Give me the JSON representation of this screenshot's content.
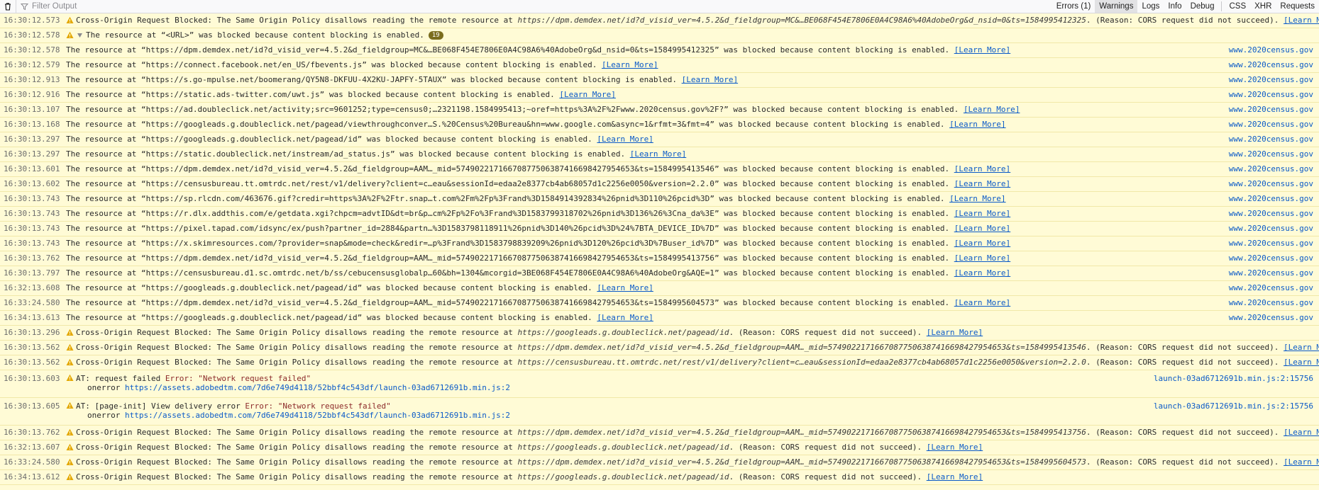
{
  "toolbar": {
    "filter_placeholder": "Filter Output",
    "buttons": [
      "Errors (1)",
      "Warnings",
      "Logs",
      "Info",
      "Debug"
    ],
    "buttons2": [
      "CSS",
      "XHR",
      "Requests"
    ]
  },
  "learn_more": "[Learn More]",
  "rows": [
    {
      "t": "16:30:12.573",
      "pre": "Cross-Origin Request Blocked: The Same Origin Policy disallows reading the remote resource at ",
      "url": "https://dpm.demdex.net/id?d_visid_ver=4.5.2&d_fieldgroup=MC&…BE068F454E7806E0A4C98A6%40AdobeOrg&d_nsid=0&ts=1584995412325",
      "post": ". (Reason: CORS request did not succeed). "
    },
    {
      "t": "16:30:12.578",
      "group": "The resource at “<URL>” was blocked because content blocking is enabled.",
      "count": "19"
    },
    {
      "t": "16:30:12.578",
      "child": true,
      "url": "https://dpm.demdex.net/id?d_visid_ver=4.5.2&d_fieldgroup=MC&…BE068F454E7806E0A4C98A6%40AdobeOrg&d_nsid=0&ts=1584995412325",
      "src": "www.2020census.gov"
    },
    {
      "t": "16:30:12.579",
      "child": true,
      "url": "https://connect.facebook.net/en_US/fbevents.js",
      "src": "www.2020census.gov"
    },
    {
      "t": "16:30:12.913",
      "child": true,
      "url": "https://s.go-mpulse.net/boomerang/QY5N8-DKFUU-4X2KU-JAPFY-5TAUX",
      "src": "www.2020census.gov"
    },
    {
      "t": "16:30:12.916",
      "child": true,
      "url": "https://static.ads-twitter.com/uwt.js",
      "src": "www.2020census.gov"
    },
    {
      "t": "16:30:13.107",
      "child": true,
      "url": "https://ad.doubleclick.net/activity;src=9601252;type=census0;…2321198.1584995413;~oref=https%3A%2F%2Fwww.2020census.gov%2F?",
      "src": "www.2020census.gov"
    },
    {
      "t": "16:30:13.168",
      "child": true,
      "url": "https://googleads.g.doubleclick.net/pagead/viewthroughconver…S.%20Census%20Bureau&hn=www.google.com&async=1&rfmt=3&fmt=4",
      "src": "www.2020census.gov"
    },
    {
      "t": "16:30:13.297",
      "child": true,
      "url": "https://googleads.g.doubleclick.net/pagead/id",
      "src": "www.2020census.gov"
    },
    {
      "t": "16:30:13.297",
      "child": true,
      "url": "https://static.doubleclick.net/instream/ad_status.js",
      "src": "www.2020census.gov"
    },
    {
      "t": "16:30:13.601",
      "child": true,
      "url": "https://dpm.demdex.net/id?d_visid_ver=4.5.2&d_fieldgroup=AAM…_mid=57490221716670877506387416698427954653&ts=1584995413546",
      "src": "www.2020census.gov"
    },
    {
      "t": "16:30:13.602",
      "child": true,
      "url": "https://censusbureau.tt.omtrdc.net/rest/v1/delivery?client=c…eau&sessionId=edaa2e8377cb4ab68057d1c2256e0050&version=2.2.0",
      "src": "www.2020census.gov"
    },
    {
      "t": "16:30:13.743",
      "child": true,
      "url": "https://sp.rlcdn.com/463676.gif?credir=https%3A%2F%2Ftr.snap…t.com%2Fm%2Fp%3Frand%3D1584914392834%26pnid%3D110%26pcid%3D",
      "src": "www.2020census.gov"
    },
    {
      "t": "16:30:13.743",
      "child": true,
      "url": "https://r.dlx.addthis.com/e/getdata.xgi?chpcm=advtID&dt=br&p…cm%2Fp%2Fo%3Frand%3D1583799318702%26pnid%3D136%26%3Cna_da%3E",
      "src": "www.2020census.gov"
    },
    {
      "t": "16:30:13.743",
      "child": true,
      "url": "https://pixel.tapad.com/idsync/ex/push?partner_id=2884&partn…%3D1583798118911%26pnid%3D140%26pcid%3D%24%7BTA_DEVICE_ID%7D",
      "src": "www.2020census.gov"
    },
    {
      "t": "16:30:13.743",
      "child": true,
      "url": "https://x.skimresources.com/?provider=snap&mode=check&redir=…p%3Frand%3D1583798839209%26pnid%3D120%26pcid%3D%7Buser_id%7D",
      "src": "www.2020census.gov"
    },
    {
      "t": "16:30:13.762",
      "child": true,
      "url": "https://dpm.demdex.net/id?d_visid_ver=4.5.2&d_fieldgroup=AAM…_mid=57490221716670877506387416698427954653&ts=1584995413756",
      "src": "www.2020census.gov"
    },
    {
      "t": "16:30:13.797",
      "child": true,
      "url": "https://censusbureau.d1.sc.omtrdc.net/b/ss/cebucensusglobalp…60&bh=1304&mcorgid=3BE068F454E7806E0A4C98A6%40AdobeOrg&AQE=1",
      "src": "www.2020census.gov"
    },
    {
      "t": "16:32:13.608",
      "child": true,
      "url": "https://googleads.g.doubleclick.net/pagead/id",
      "src": "www.2020census.gov"
    },
    {
      "t": "16:33:24.580",
      "child": true,
      "url": "https://dpm.demdex.net/id?d_visid_ver=4.5.2&d_fieldgroup=AAM…_mid=57490221716670877506387416698427954653&ts=1584995604573",
      "src": "www.2020census.gov"
    },
    {
      "t": "16:34:13.613",
      "child": true,
      "url": "https://googleads.g.doubleclick.net/pagead/id",
      "src": "www.2020census.gov"
    },
    {
      "t": "16:30:13.296",
      "pre": "Cross-Origin Request Blocked: The Same Origin Policy disallows reading the remote resource at ",
      "url": "https://googleads.g.doubleclick.net/pagead/id",
      "post": ". (Reason: CORS request did not succeed). "
    },
    {
      "t": "16:30:13.562",
      "pre": "Cross-Origin Request Blocked: The Same Origin Policy disallows reading the remote resource at ",
      "url": "https://dpm.demdex.net/id?d_visid_ver=4.5.2&d_fieldgroup=AAM…_mid=57490221716670877506387416698427954653&ts=1584995413546",
      "post": ". (Reason: CORS request did not succeed). "
    },
    {
      "t": "16:30:13.562",
      "pre": "Cross-Origin Request Blocked: The Same Origin Policy disallows reading the remote resource at ",
      "url": "https://censusbureau.tt.omtrdc.net/rest/v1/delivery?client=c…eau&sessionId=edaa2e8377cb4ab68057d1c2256e0050&version=2.2.0",
      "post": ". (Reason: CORS request did not succeed). "
    },
    {
      "t": "16:30:13.603",
      "multi": true,
      "line1": "AT: request failed ",
      "err": "Error: \"Network request failed\"",
      "line2a": "onerror ",
      "line2b": "https://assets.adobedtm.com/7d6e749d4118/52bbf4c543df/launch-03ad6712691b.min.js:2",
      "src": "launch-03ad6712691b.min.js:2:15756"
    },
    {
      "t": "16:30:13.605",
      "multi": true,
      "line1": "AT: [page-init] View delivery error ",
      "err": "Error: \"Network request failed\"",
      "line2a": "onerror ",
      "line2b": "https://assets.adobedtm.com/7d6e749d4118/52bbf4c543df/launch-03ad6712691b.min.js:2",
      "src": "launch-03ad6712691b.min.js:2:15756"
    },
    {
      "t": "16:30:13.762",
      "pre": "Cross-Origin Request Blocked: The Same Origin Policy disallows reading the remote resource at ",
      "url": "https://dpm.demdex.net/id?d_visid_ver=4.5.2&d_fieldgroup=AAM…_mid=57490221716670877506387416698427954653&ts=1584995413756",
      "post": ". (Reason: CORS request did not succeed). "
    },
    {
      "t": "16:32:13.607",
      "pre": "Cross-Origin Request Blocked: The Same Origin Policy disallows reading the remote resource at ",
      "url": "https://googleads.g.doubleclick.net/pagead/id",
      "post": ". (Reason: CORS request did not succeed). "
    },
    {
      "t": "16:33:24.580",
      "pre": "Cross-Origin Request Blocked: The Same Origin Policy disallows reading the remote resource at ",
      "url": "https://dpm.demdex.net/id?d_visid_ver=4.5.2&d_fieldgroup=AAM…_mid=57490221716670877506387416698427954653&ts=1584995604573",
      "post": ". (Reason: CORS request did not succeed). "
    },
    {
      "t": "16:34:13.612",
      "pre": "Cross-Origin Request Blocked: The Same Origin Policy disallows reading the remote resource at ",
      "url": "https://googleads.g.doubleclick.net/pagead/id",
      "post": ". (Reason: CORS request did not succeed). "
    }
  ],
  "child_pre": "The resource at “",
  "child_post": "” was blocked because content blocking is enabled. "
}
